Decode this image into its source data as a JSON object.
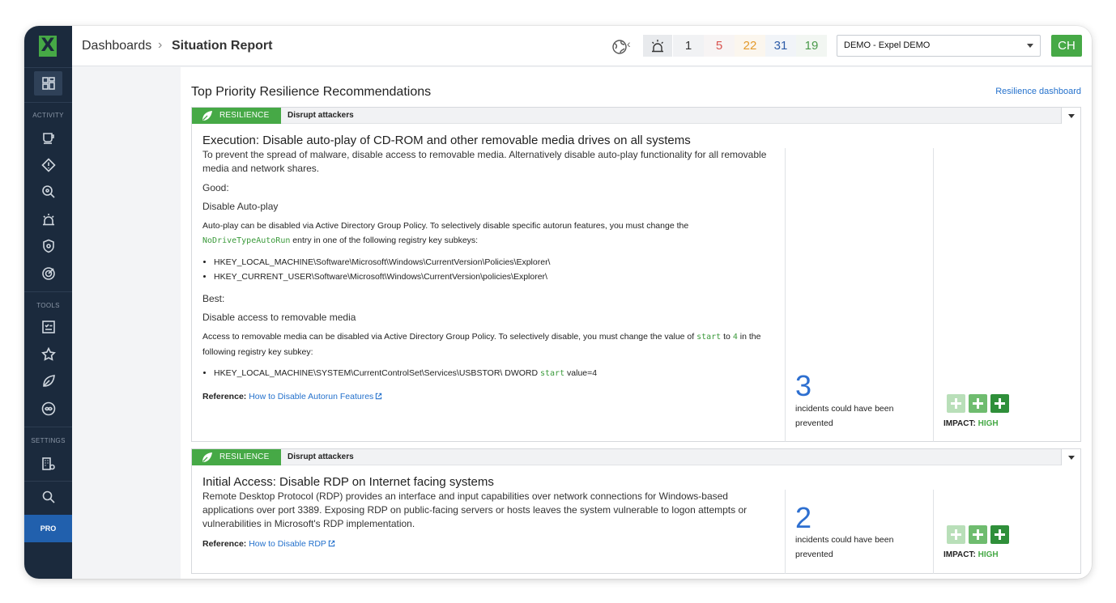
{
  "sidebar": {
    "logo": "X",
    "sections": {
      "activity": "ACTIVITY",
      "tools": "TOOLS",
      "settings": "SETTINGS"
    },
    "pro": "PRO"
  },
  "header": {
    "breadcrumb": [
      "Dashboards",
      "Situation Report"
    ],
    "separator": "›",
    "severity_counts": [
      {
        "value": "1",
        "color": "#333333"
      },
      {
        "value": "5",
        "color": "#d9534f"
      },
      {
        "value": "22",
        "color": "#e49a2b"
      },
      {
        "value": "31",
        "color": "#2d5ca8"
      },
      {
        "value": "19",
        "color": "#4a9a4a"
      }
    ],
    "org_select": "DEMO - Expel DEMO",
    "avatar": "CH"
  },
  "main": {
    "title": "Top Priority Resilience Recommendations",
    "link": "Resilience dashboard",
    "cards": [
      {
        "tag": "RESILIENCE",
        "subtag": "Disrupt attackers",
        "title": "Execution: Disable auto-play of CD-ROM and other removable media drives on all systems",
        "intro": "To prevent the spread of malware, disable access to removable media. Alternatively disable auto-play functionality for all removable media and network shares.",
        "good_label": "Good",
        "good_title": "Disable Auto-play",
        "good_text_1": "Auto-play can be disabled via Active Directory Group Policy. To selectively disable specific autorun features, you must change the",
        "good_code": "NoDriveTypeAutoRun",
        "good_text_2": "entry in one of the following registry key subkeys:",
        "good_keys": [
          "HKEY_LOCAL_MACHINE\\Software\\Microsoft\\Windows\\CurrentVersion\\Policies\\Explorer\\",
          "HKEY_CURRENT_USER\\Software\\Microsoft\\Windows\\CurrentVersion\\policies\\Explorer\\"
        ],
        "best_label": "Best",
        "best_title": "Disable access to removable media",
        "best_text_1": "Access to removable media can be disabled via Active Directory Group Policy. To selectively disable, you must change the value of",
        "best_code_1": "start",
        "best_text_2": "to",
        "best_code_2": "4",
        "best_text_3": "in the following registry key subkey:",
        "best_key_prefix": "HKEY_LOCAL_MACHINE\\SYSTEM\\CurrentControlSet\\Services\\USBSTOR\\ DWORD",
        "best_key_code": "start",
        "best_key_suffix": "value=4",
        "ref_label": "Reference:",
        "ref_link": "How to Disable Autorun Features",
        "incidents": "3",
        "incidents_text": "incidents could have been prevented",
        "impact_label": "IMPACT:",
        "impact_level": "HIGH"
      },
      {
        "tag": "RESILIENCE",
        "subtag": "Disrupt attackers",
        "title": "Initial Access: Disable RDP on Internet facing systems",
        "intro": "Remote Desktop Protocol (RDP) provides an interface and input capabilities over network connections for Windows-based applications over port 3389. Exposing RDP on public-facing servers or hosts leaves the system vulnerable to logon attempts or vulnerabilities in Microsoft's RDP implementation.",
        "ref_label": "Reference:",
        "ref_link": "How to Disable RDP",
        "incidents": "2",
        "incidents_text": "incidents could have been prevented",
        "impact_label": "IMPACT:",
        "impact_level": "HIGH"
      }
    ]
  }
}
